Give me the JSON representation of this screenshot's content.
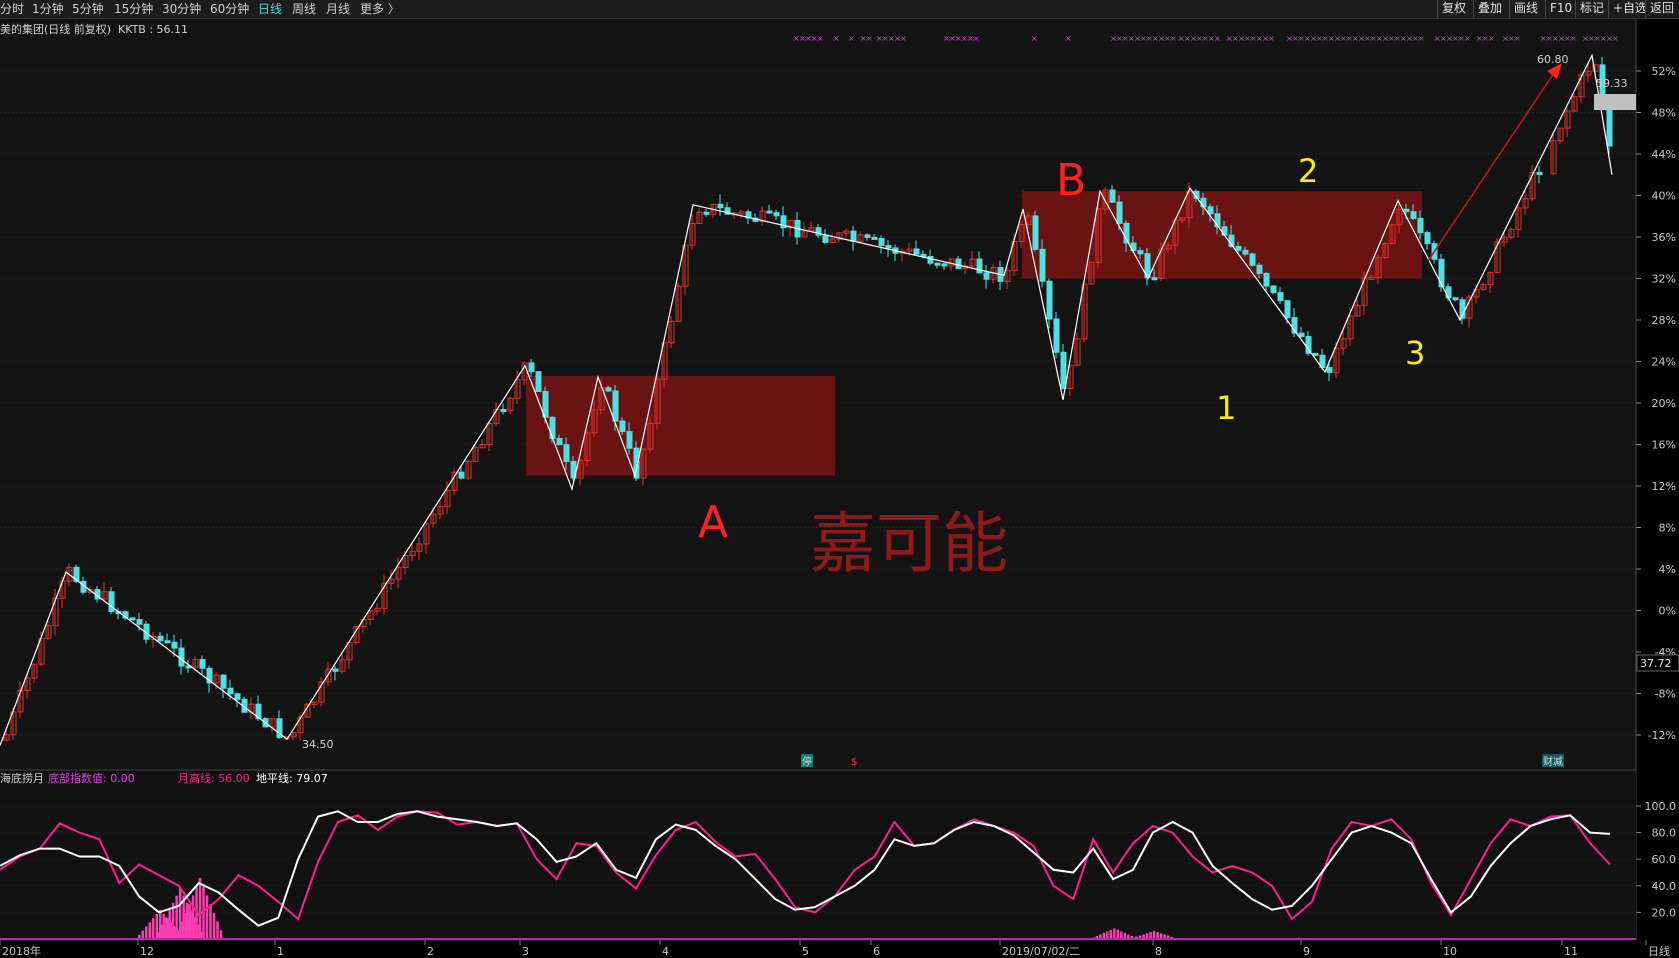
{
  "toolbar": {
    "periods": [
      "分时",
      "1分钟",
      "5分钟",
      "15分钟",
      "30分钟",
      "60分钟",
      "日线",
      "周线",
      "月线",
      "更多 〉"
    ],
    "active_period": "日线",
    "right_buttons": [
      "复权",
      "叠加",
      "画线",
      "F10",
      "标记",
      "+自选",
      "返回"
    ]
  },
  "main_panel": {
    "title": "美的集团(日线 前复权)",
    "indicator_label": "KKTB : 56.11",
    "current_price_tag": "37.72",
    "high_price_label": "60.80",
    "low_price_label": "34.50",
    "marker_price_label": "59.33",
    "annotations": {
      "zone_a": "A",
      "zone_b": "B",
      "points": [
        "1",
        "2",
        "3"
      ],
      "watermark": "嘉可能"
    },
    "small_markers": [
      "停",
      "$",
      "财减"
    ],
    "colors": {
      "up_candle": "#e0302a",
      "down_candle": "#4fe0e6",
      "zone_fill": "#7a1414",
      "zigzag": "#ffffff",
      "annotation_red": "#ff2020",
      "annotation_yellow": "#ffee00",
      "marker_purple": "#e040e0"
    }
  },
  "sub_panel": {
    "title": "海底捞月",
    "base_label": "底部指数值: 0.00",
    "month_label": "月高线: 56.00",
    "horizon_label": "地平线: 79.07",
    "colors": {
      "month_line": "#ff1e8c",
      "horizon_line": "#ffffff",
      "bars": "#ff3cb4"
    }
  },
  "x_axis_labels": [
    "2018年",
    "12",
    "1",
    "2",
    "3",
    "4",
    "5",
    "6",
    "2019/07/02/二",
    "8",
    "9",
    "10",
    "11",
    "日线"
  ],
  "chart_data": [
    {
      "type": "candlestick",
      "title": "美的集团(日线 前复权)",
      "y_axis": {
        "unit": "percent",
        "ticks": [
          "52%",
          "48%",
          "44%",
          "40%",
          "36%",
          "32%",
          "28%",
          "24%",
          "20%",
          "16%",
          "12%",
          "8%",
          "4%",
          "0%",
          "-4%",
          "-8%",
          "-12%"
        ]
      },
      "x_months": [
        "2018年",
        "12",
        "1",
        "2",
        "3",
        "4",
        "5",
        "6",
        "7",
        "8",
        "9",
        "10",
        "11"
      ],
      "zigzag_points_pct": [
        {
          "label": "start",
          "value": -13
        },
        {
          "label": "high",
          "value": 3.7
        },
        {
          "label": "low",
          "value": -12.4
        },
        {
          "label": "high",
          "value": 23.6
        },
        {
          "label": "low",
          "value": 11.7
        },
        {
          "label": "high",
          "value": 22.5
        },
        {
          "label": "low",
          "value": 13.0
        },
        {
          "label": "high",
          "value": 39.1
        },
        {
          "label": "low",
          "value": 32.3
        },
        {
          "label": "high",
          "value": 38.7
        },
        {
          "label": "low",
          "value": 20.3
        },
        {
          "label": "high",
          "value": 40.4
        },
        {
          "label": "low",
          "value": 32.0
        },
        {
          "label": "high",
          "value": 40.7
        },
        {
          "label": "1",
          "value": 23.0
        },
        {
          "label": "2",
          "value": 39.5
        },
        {
          "label": "3",
          "value": 28.0
        },
        {
          "label": "peak",
          "value": 53.5
        },
        {
          "label": "end",
          "value": 42.0
        }
      ],
      "zones_pct": [
        {
          "label": "A",
          "from": 13.0,
          "to": 22.6
        },
        {
          "label": "B",
          "from": 32.0,
          "to": 40.4
        }
      ],
      "labels": {
        "high": "60.80",
        "low": "34.50",
        "current": "37.72",
        "marker": "59.33"
      }
    },
    {
      "type": "line",
      "title": "海底捞月",
      "y_axis": {
        "ticks": [
          "100.0",
          "80.0",
          "60.0",
          "40.0",
          "20.0"
        ],
        "ylim": [
          0,
          100
        ]
      },
      "series": [
        {
          "name": "月高线",
          "values": [
            52,
            62,
            68,
            87,
            80,
            75,
            42,
            56,
            48,
            40,
            18,
            30,
            48,
            40,
            28,
            15,
            58,
            88,
            93,
            82,
            92,
            96,
            95,
            86,
            88,
            85,
            87,
            60,
            45,
            72,
            70,
            50,
            38,
            63,
            82,
            88,
            73,
            62,
            64,
            45,
            24,
            20,
            32,
            52,
            62,
            88,
            70,
            72,
            82,
            90,
            85,
            80,
            70,
            40,
            30,
            75,
            50,
            72,
            85,
            80,
            62,
            50,
            55,
            50,
            40,
            15,
            28,
            68,
            88,
            85,
            90,
            75,
            42,
            18,
            45,
            72,
            90,
            85,
            92,
            93,
            72,
            56
          ]
        },
        {
          "name": "地平线",
          "values": [
            55,
            63,
            68,
            68,
            62,
            62,
            55,
            32,
            20,
            25,
            42,
            35,
            22,
            10,
            16,
            60,
            92,
            96,
            88,
            88,
            94,
            96,
            92,
            90,
            88,
            85,
            87,
            75,
            58,
            62,
            72,
            52,
            46,
            75,
            86,
            82,
            70,
            60,
            45,
            30,
            22,
            24,
            32,
            40,
            52,
            75,
            70,
            72,
            82,
            88,
            85,
            78,
            65,
            52,
            50,
            68,
            45,
            52,
            80,
            88,
            80,
            55,
            42,
            30,
            22,
            25,
            40,
            60,
            80,
            85,
            80,
            72,
            45,
            20,
            32,
            55,
            72,
            85,
            90,
            93,
            80,
            79
          ]
        },
        {
          "name": "底部指数值",
          "values": [
            0,
            0,
            0,
            0,
            0,
            0,
            0,
            0,
            22,
            38,
            46,
            0,
            0,
            0,
            0,
            0,
            0,
            0,
            0,
            0,
            0,
            0,
            0,
            0,
            0,
            0,
            0,
            0,
            0,
            0,
            0,
            0,
            0,
            0,
            0,
            0,
            0,
            0,
            0,
            0,
            0,
            0,
            0,
            0,
            0,
            0,
            0,
            0,
            0,
            0,
            0,
            0,
            0,
            0,
            0,
            0,
            8,
            0,
            6,
            0,
            0,
            0,
            0,
            0,
            0,
            0,
            0,
            0,
            0,
            0,
            0,
            0,
            0,
            0,
            0,
            0,
            0,
            0,
            0,
            0,
            0,
            0
          ]
        }
      ]
    }
  ]
}
